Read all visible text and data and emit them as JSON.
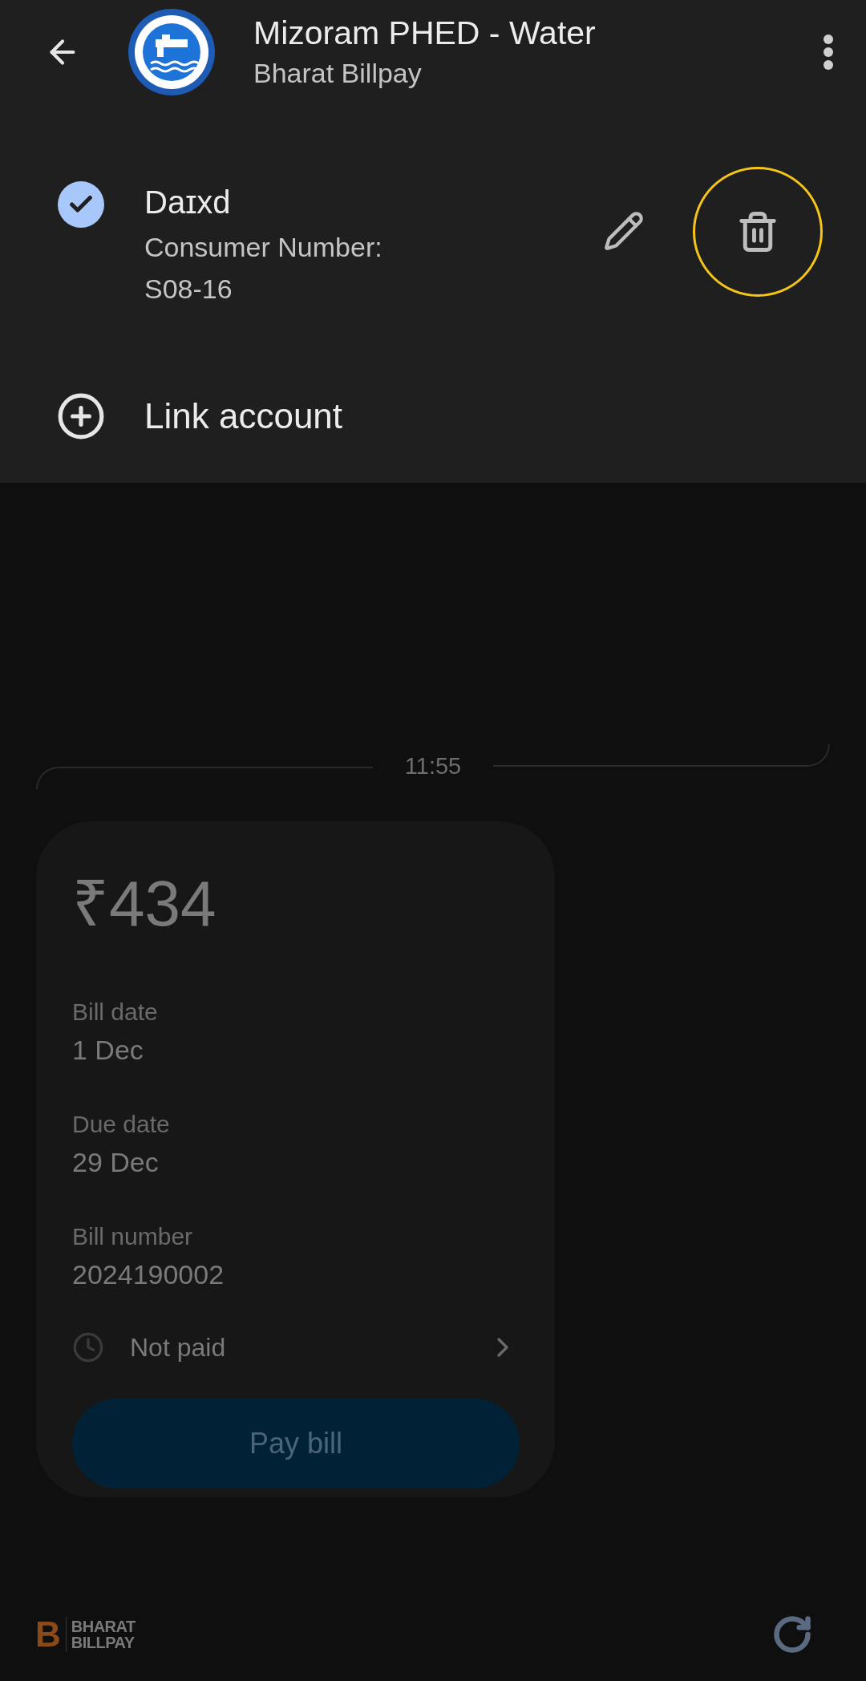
{
  "header": {
    "title": "Mizoram PHED - Water",
    "subtitle": "Bharat Billpay"
  },
  "account": {
    "name": "Daɪxd",
    "selected": true,
    "consumer_label": "Consumer Number:",
    "consumer_number": "S08-16",
    "delete_highlighted": true
  },
  "link_account": "Link account",
  "timestamp": "11:55",
  "bill": {
    "amount": "₹434",
    "fields": [
      {
        "label": "Bill date",
        "value": "1 Dec"
      },
      {
        "label": "Due date",
        "value": "29 Dec"
      },
      {
        "label": "Bill number",
        "value": "2024190002"
      }
    ],
    "status": "Not paid",
    "pay_button": "Pay bill"
  },
  "footer": {
    "logo_letter": "B",
    "logo_line1": "BHARAT",
    "logo_line2": "BILLPAY"
  }
}
